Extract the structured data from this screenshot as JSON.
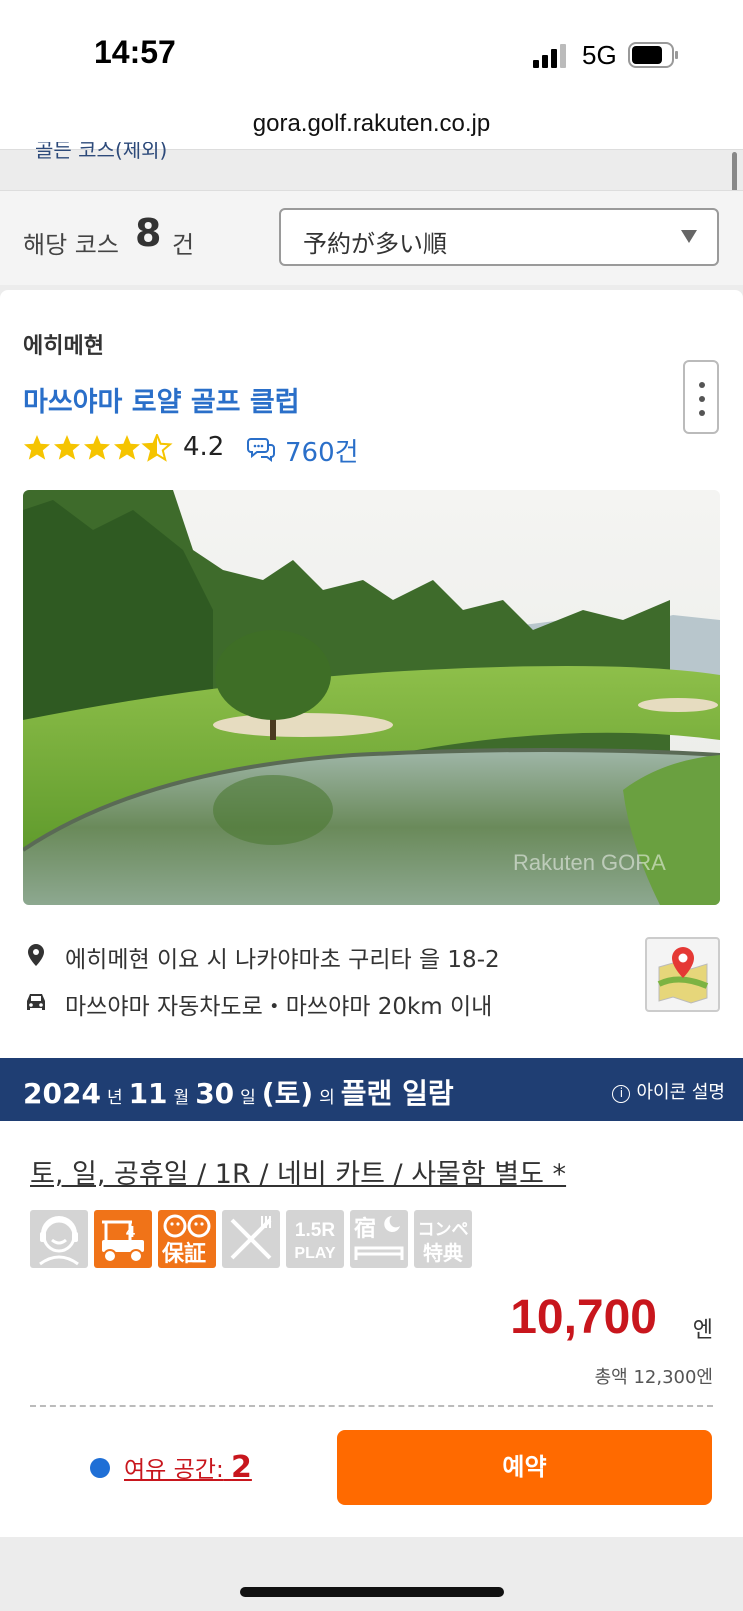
{
  "status_bar": {
    "time": "14:57",
    "network": "5G"
  },
  "browser": {
    "url": "gora.golf.rakuten.co.jp"
  },
  "cut_off_text": "골든 코스(제외)",
  "results": {
    "label": "해당 코스",
    "count": "8",
    "unit": "건"
  },
  "sort": {
    "selected": "予約が多い順"
  },
  "course": {
    "prefecture": "에히메현",
    "name": "마쓰야마 로얄 골프 클럽",
    "rating": "4.2",
    "rating_value": 4.2,
    "reviews": "760건",
    "photo_watermark": "Rakuten GORA",
    "address": "에히메현 이요  시 나카야마초 구리타 을 18-2",
    "access": "마쓰야마 자동차도로・마쓰야마   20km 이내"
  },
  "plan_header": {
    "year": "2024",
    "year_unit": "년",
    "month": "11",
    "month_unit": "월",
    "day": "30",
    "day_unit": "일",
    "weekday": "(토)",
    "of": "의",
    "title": "플랜 일람",
    "legend": "아이콘 설명"
  },
  "plan": {
    "title": "토, 일, 공휴일 / 1R / 네비 카트 / 사물함 별도 *",
    "feature_icons": [
      {
        "name": "caddie-icon",
        "active": false
      },
      {
        "name": "cart-4-icon",
        "active": true,
        "text": "4"
      },
      {
        "name": "guarantee-icon",
        "active": true,
        "text": "保証"
      },
      {
        "name": "meal-icon",
        "active": false
      },
      {
        "name": "play-1-5r-icon",
        "active": false,
        "text": "1.5R PLAY"
      },
      {
        "name": "lodging-icon",
        "active": false,
        "text": "宿"
      },
      {
        "name": "compe-special-icon",
        "active": false,
        "text": "コンペ特典"
      }
    ],
    "price": "10,700",
    "price_unit": "엔",
    "total": "총액 12,300엔",
    "availability_label": "여유 공간:",
    "availability_count": "2",
    "reserve_label": "예약"
  },
  "colors": {
    "accent_blue": "#2a6fc9",
    "header_navy": "#1f3e73",
    "price_red": "#c8161d",
    "reserve_orange": "#ff6a00"
  }
}
